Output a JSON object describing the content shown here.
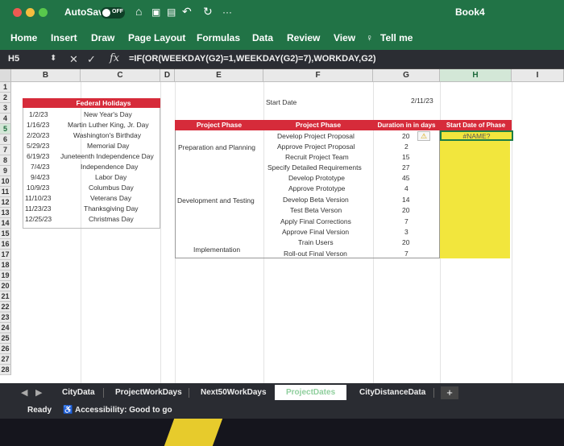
{
  "titlebar": {
    "autosave_label": "AutoSave",
    "autosave_state": "OFF",
    "more": "···",
    "document_title": "Book4"
  },
  "ribbon": {
    "tabs": [
      "Home",
      "Insert",
      "Draw",
      "Page Layout",
      "Formulas",
      "Data",
      "Review",
      "View",
      "Tell me"
    ]
  },
  "formula_bar": {
    "name_box": "H5",
    "fx": "fx",
    "formula": "=IF(OR(WEEKDAY(G2)=1,WEEKDAY(G2)=7),WORKDAY,G2)"
  },
  "columns": [
    "B",
    "C",
    "D",
    "E",
    "F",
    "G",
    "H",
    "I"
  ],
  "rows": [
    "1",
    "2",
    "3",
    "4",
    "5",
    "6",
    "7",
    "8",
    "9",
    "10",
    "11",
    "12",
    "13",
    "14",
    "15",
    "16",
    "17",
    "18",
    "19",
    "20",
    "21",
    "22",
    "23",
    "24",
    "25",
    "26",
    "27",
    "28"
  ],
  "holidays": {
    "header": "Federal Holidays",
    "items": [
      {
        "date": "1/2/23",
        "name": "New Year's Day"
      },
      {
        "date": "1/16/23",
        "name": "Martin Luther King, Jr. Day"
      },
      {
        "date": "2/20/23",
        "name": "Washington's Birthday"
      },
      {
        "date": "5/29/23",
        "name": "Memorial Day"
      },
      {
        "date": "6/19/23",
        "name": "Juneteenth Independence Day"
      },
      {
        "date": "7/4/23",
        "name": "Independence Day"
      },
      {
        "date": "9/4/23",
        "name": "Labor Day"
      },
      {
        "date": "10/9/23",
        "name": "Columbus Day"
      },
      {
        "date": "11/10/23",
        "name": "Veterans Day"
      },
      {
        "date": "11/23/23",
        "name": "Thanksgiving Day"
      },
      {
        "date": "12/25/23",
        "name": "Christmas Day"
      }
    ]
  },
  "start_date": {
    "label": "Start Date",
    "value": "2/11/23"
  },
  "project_table": {
    "headers": [
      "Project Phase",
      "Project Phase",
      "Duration in in days",
      "Start Date of Phase"
    ],
    "groups": [
      "Preparation and Planning",
      "Development and Testing",
      "Implementation"
    ],
    "tasks": [
      {
        "task": "Develop Project Proposal",
        "duration": "20"
      },
      {
        "task": "Approve Project Proposal",
        "duration": "2"
      },
      {
        "task": "Recruit Project Team",
        "duration": "15"
      },
      {
        "task": "Specify Detailed Requirements",
        "duration": "27"
      },
      {
        "task": "Develop Prototype",
        "duration": "45"
      },
      {
        "task": "Approve Prototype",
        "duration": "4"
      },
      {
        "task": "Develop Beta Version",
        "duration": "14"
      },
      {
        "task": "Test Beta Verson",
        "duration": "20"
      },
      {
        "task": "Apply Final Corrections",
        "duration": "7"
      },
      {
        "task": "Approve Final Version",
        "duration": "3"
      },
      {
        "task": "Train Users",
        "duration": "20"
      },
      {
        "task": "Roll-out Final Verson",
        "duration": "7"
      }
    ],
    "first_start_value": "#NAME?"
  },
  "sheet_tabs": [
    "CityData",
    "ProjectWorkDays",
    "Next50WorkDays",
    "ProjectDates",
    "CityDistanceData"
  ],
  "add_sheet": "+",
  "status": {
    "ready": "Ready",
    "accessibility": "Accessibility: Good to go"
  },
  "colors": {
    "excel_green": "#217346",
    "header_red": "#d62b3a",
    "highlight_yellow": "#f2e63d"
  }
}
